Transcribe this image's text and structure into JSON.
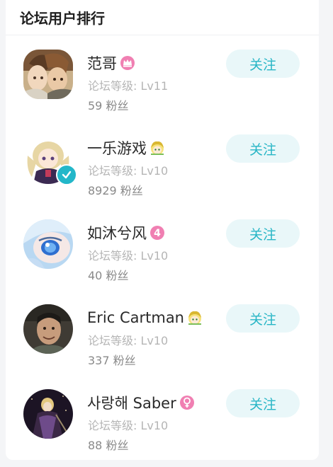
{
  "header": {
    "title": "论坛用户排行"
  },
  "users": [
    {
      "name": "范哥",
      "level": "论坛等级: Lv11",
      "fans": "59 粉丝",
      "follow_label": "关注",
      "badge_icon": "crown-badge-icon",
      "verified": false
    },
    {
      "name": "一乐游戏",
      "level": "论坛等级: Lv10",
      "fans": "8929 粉丝",
      "follow_label": "关注",
      "badge_icon": "anime-face-badge-icon",
      "verified": true
    },
    {
      "name": "如沐兮风",
      "level": "论坛等级: Lv10",
      "fans": "40 粉丝",
      "follow_label": "关注",
      "badge_icon": "number-4-badge-icon",
      "badge_text": "4",
      "verified": false
    },
    {
      "name": "Eric Cartman",
      "level": "论坛等级: Lv10",
      "fans": "337 粉丝",
      "follow_label": "关注",
      "badge_icon": "anime-face-badge-icon",
      "verified": false
    },
    {
      "name": "사랑해 Saber",
      "level": "论坛等级: Lv10",
      "fans": "88 粉丝",
      "follow_label": "关注",
      "badge_icon": "female-symbol-badge-icon",
      "verified": false
    }
  ],
  "colors": {
    "accent": "#28b6c6",
    "button_bg": "#e9f7f9",
    "pink_badge": "#f07fb2",
    "verify": "#23b7c9"
  }
}
